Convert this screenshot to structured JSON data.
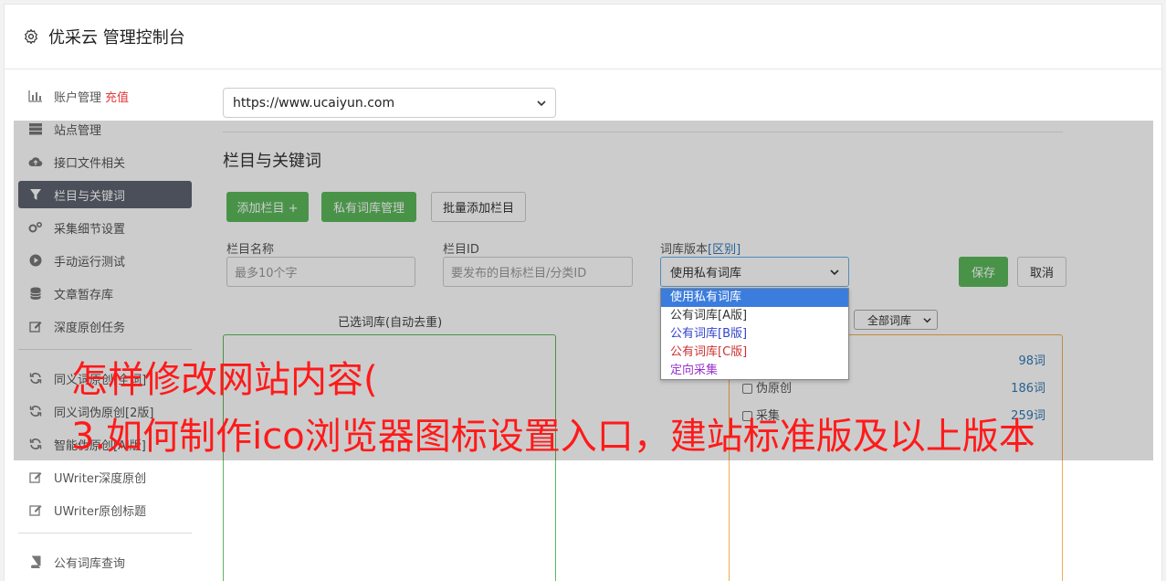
{
  "header": {
    "title": "优采云 管理控制台",
    "icon": "gear-icon"
  },
  "sidebar": {
    "items": [
      {
        "label": "账户管理",
        "badge": "充值",
        "icon": "chart-icon"
      },
      {
        "label": "站点管理",
        "icon": "server-icon"
      },
      {
        "label": "接口文件相关",
        "icon": "cloud-upload-icon"
      },
      {
        "label": "栏目与关键词",
        "icon": "filter-icon",
        "active": true
      },
      {
        "label": "采集细节设置",
        "icon": "cogs-icon"
      },
      {
        "label": "手动运行测试",
        "icon": "play-icon"
      },
      {
        "label": "文章暂存库",
        "icon": "database-icon"
      },
      {
        "label": "深度原创任务",
        "icon": "edit-icon"
      },
      {
        "label": "同义词原创[全词]",
        "icon": "refresh-icon"
      },
      {
        "label": "同义词伪原创[2版]",
        "icon": "refresh-icon"
      },
      {
        "label": "智能伪原创[AI版]",
        "icon": "refresh-icon"
      },
      {
        "label": "UWriter深度原创",
        "icon": "edit-icon"
      },
      {
        "label": "UWriter原创标题",
        "icon": "edit-icon"
      },
      {
        "label": "公有词库查询",
        "icon": "book-icon"
      }
    ]
  },
  "main": {
    "site_select": "https://www.ucaiyun.com",
    "section_title": "栏目与关键词",
    "buttons": {
      "add_column": "添加栏目 +",
      "private_lib": "私有词库管理",
      "batch_add": "批量添加栏目",
      "save": "保存",
      "cancel": "取消"
    },
    "form": {
      "name_label": "栏目名称",
      "name_placeholder": "最多10个字",
      "id_label": "栏目ID",
      "id_placeholder": "要发布的目标栏目/分类ID",
      "lib_label": "词库版本",
      "lib_label_link": "[区别]",
      "lib_selected": "使用私有词库"
    },
    "dropdown": {
      "options": [
        {
          "label": "使用私有词库",
          "color": "#ffffff"
        },
        {
          "label": "公有词库[A版]",
          "color": "#333333"
        },
        {
          "label": "公有词库[B版]",
          "color": "#3344cc"
        },
        {
          "label": "公有词库[C版]",
          "color": "#cc3333"
        },
        {
          "label": "定向采集",
          "color": "#9933cc"
        }
      ]
    },
    "selected_panel_title": "已选词库(自动去重)",
    "filter_select": "全部词库",
    "libraries": [
      {
        "name": "",
        "count": "98词"
      },
      {
        "name": "伪原创",
        "count": "186词"
      },
      {
        "name": "采集",
        "count": "259词"
      }
    ]
  },
  "overlay_text": {
    "line1": "怎样修改网站内容(",
    "line2": "3.如何制作ico浏览器图标设置入口，建站标准版及以上版本"
  }
}
